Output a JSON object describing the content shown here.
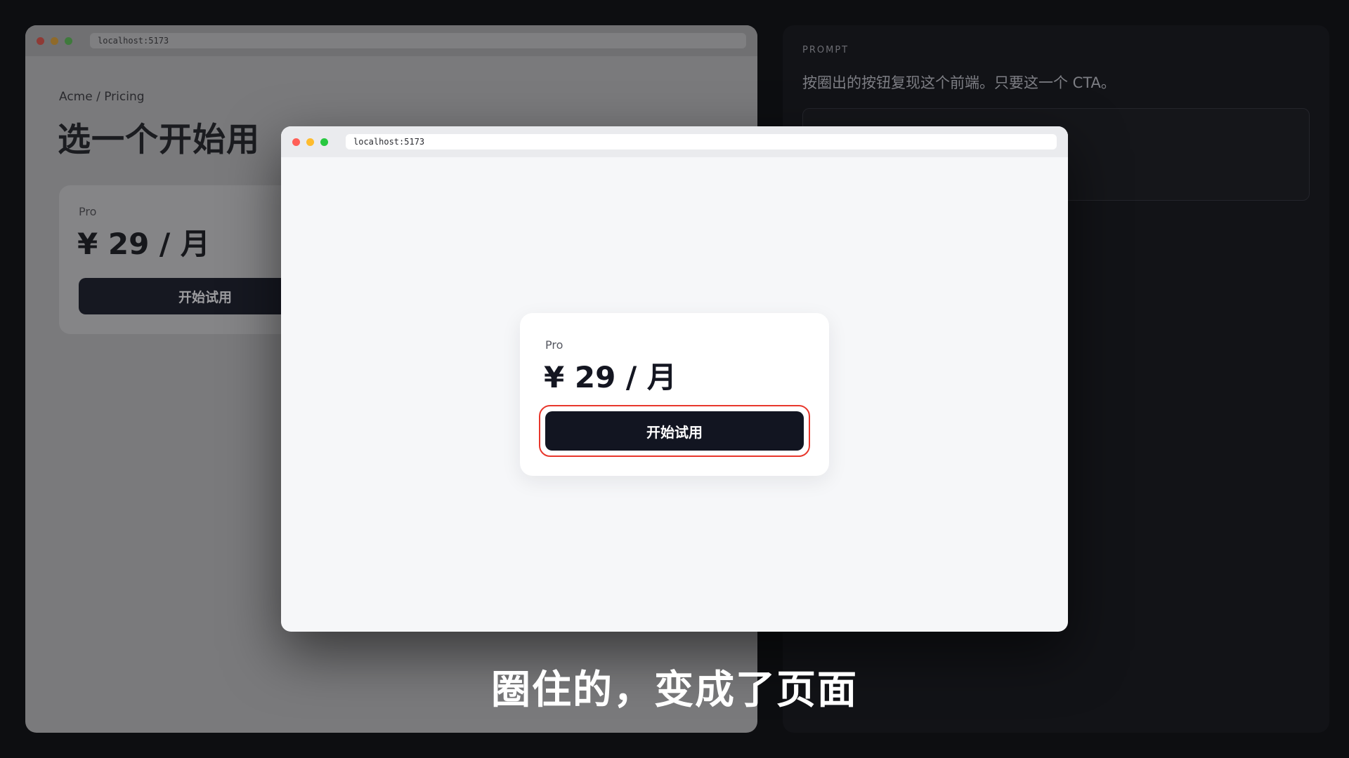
{
  "background_window": {
    "url": "localhost:5173",
    "breadcrumb": "Acme / Pricing",
    "title": "选一个开始用",
    "card": {
      "plan": "Pro",
      "price": "¥ 29 / 月",
      "cta_label": "开始试用"
    }
  },
  "prompt_panel": {
    "label": "PROMPT",
    "text": "按圈出的按钮复现这个前端。只要这一个 CTA。"
  },
  "preview_window": {
    "url": "localhost:5173",
    "card": {
      "plan": "Pro",
      "price": "¥ 29 / 月",
      "cta_label": "开始试用"
    },
    "highlight_color": "#e8372c"
  },
  "caption": "圈住的，变成了页面",
  "colors": {
    "button_bg": "#121521",
    "canvas_bg": "#0d0e11"
  }
}
